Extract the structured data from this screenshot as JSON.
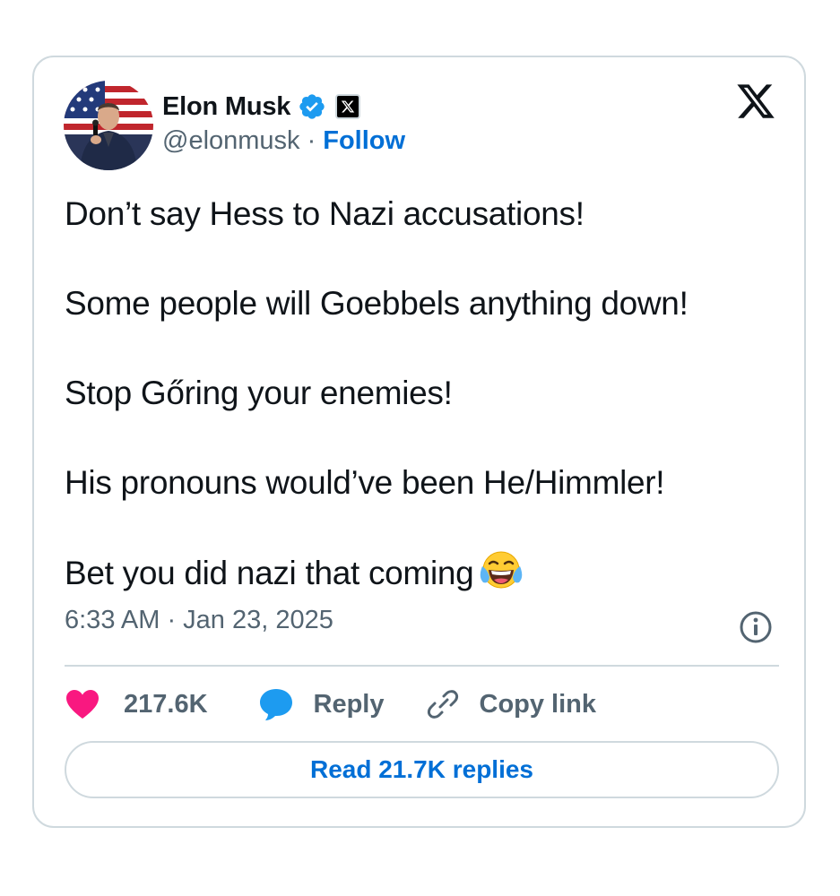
{
  "author": {
    "name": "Elon Musk",
    "handle": "@elonmusk",
    "separator": "·",
    "follow_label": "Follow",
    "avatar_icon": "profile-photo"
  },
  "tweet": {
    "paragraphs": [
      "Don’t say Hess to Nazi accusations!",
      "Some people will Goebbels anything down!",
      "Stop Gőring your enemies!",
      "His pronouns would’ve been He/Himmler!",
      "Bet you did nazi that coming"
    ],
    "trailing_emoji": "face-with-tears-of-joy",
    "timestamp": "6:33 AM · Jan 23, 2025"
  },
  "actions": {
    "like_count": "217.6K",
    "reply_label": "Reply",
    "copy_label": "Copy link"
  },
  "replies_button": {
    "label": "Read 21.7K replies"
  },
  "colors": {
    "link_blue": "#006fd6",
    "verified_blue": "#1d9bf0",
    "like_pink": "#f91880",
    "secondary_text": "#536471",
    "border": "#cfd9de"
  },
  "icons": {
    "brand": "x-logo-icon",
    "verified": "verified-badge-icon",
    "affiliation": "x-affiliation-icon",
    "info": "info-icon",
    "like": "heart-icon",
    "reply": "speech-bubble-icon",
    "copy": "link-icon"
  }
}
